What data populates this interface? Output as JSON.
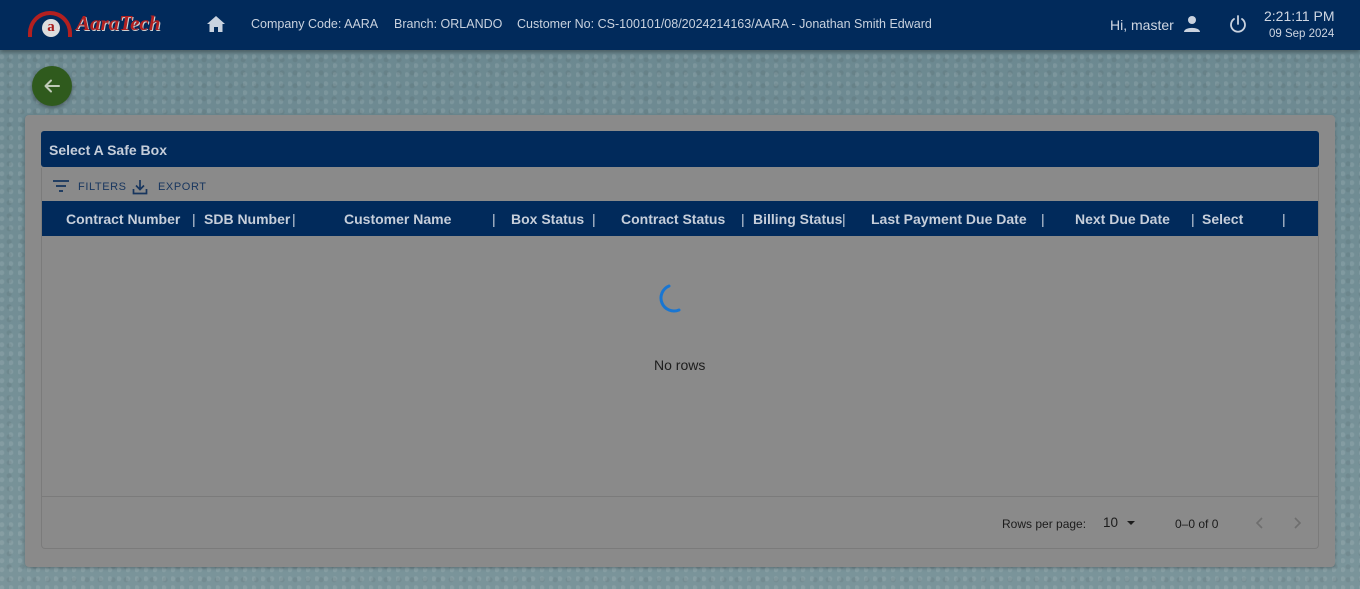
{
  "header": {
    "logo_text": "AaraTech",
    "logo_letter": "a",
    "company_code": "Company Code: AARA",
    "branch": "Branch: ORLANDO",
    "customer": "Customer No: CS-100101/08/2024214163/AARA - Jonathan Smith Edward",
    "greeting": "Hi, master",
    "time": "2:21:11 PM",
    "date": "09 Sep 2024",
    "icons": [
      "home-icon",
      "user-icon",
      "power-icon"
    ]
  },
  "back_button": {
    "icon": "arrow-left-icon"
  },
  "panel": {
    "title": "Select A Safe Box",
    "toolbar": {
      "filters_label": "FILTERS",
      "export_label": "EXPORT"
    },
    "columns": [
      "Contract Number",
      "SDB Number",
      "Customer Name",
      "Box Status",
      "Contract Status",
      "Billing Status",
      "Last Payment Due Date",
      "Next Due Date",
      "Select"
    ],
    "empty_text": "No rows",
    "pagination": {
      "rows_per_page_label": "Rows per page:",
      "rows_per_page_value": "10",
      "range_text": "0–0 of 0"
    }
  },
  "colors": {
    "header_bg": "#012a5b",
    "back_button_bg": "#2f5a1d",
    "spinner": "#1976d2",
    "panel_bg": "#8a8a8a"
  }
}
